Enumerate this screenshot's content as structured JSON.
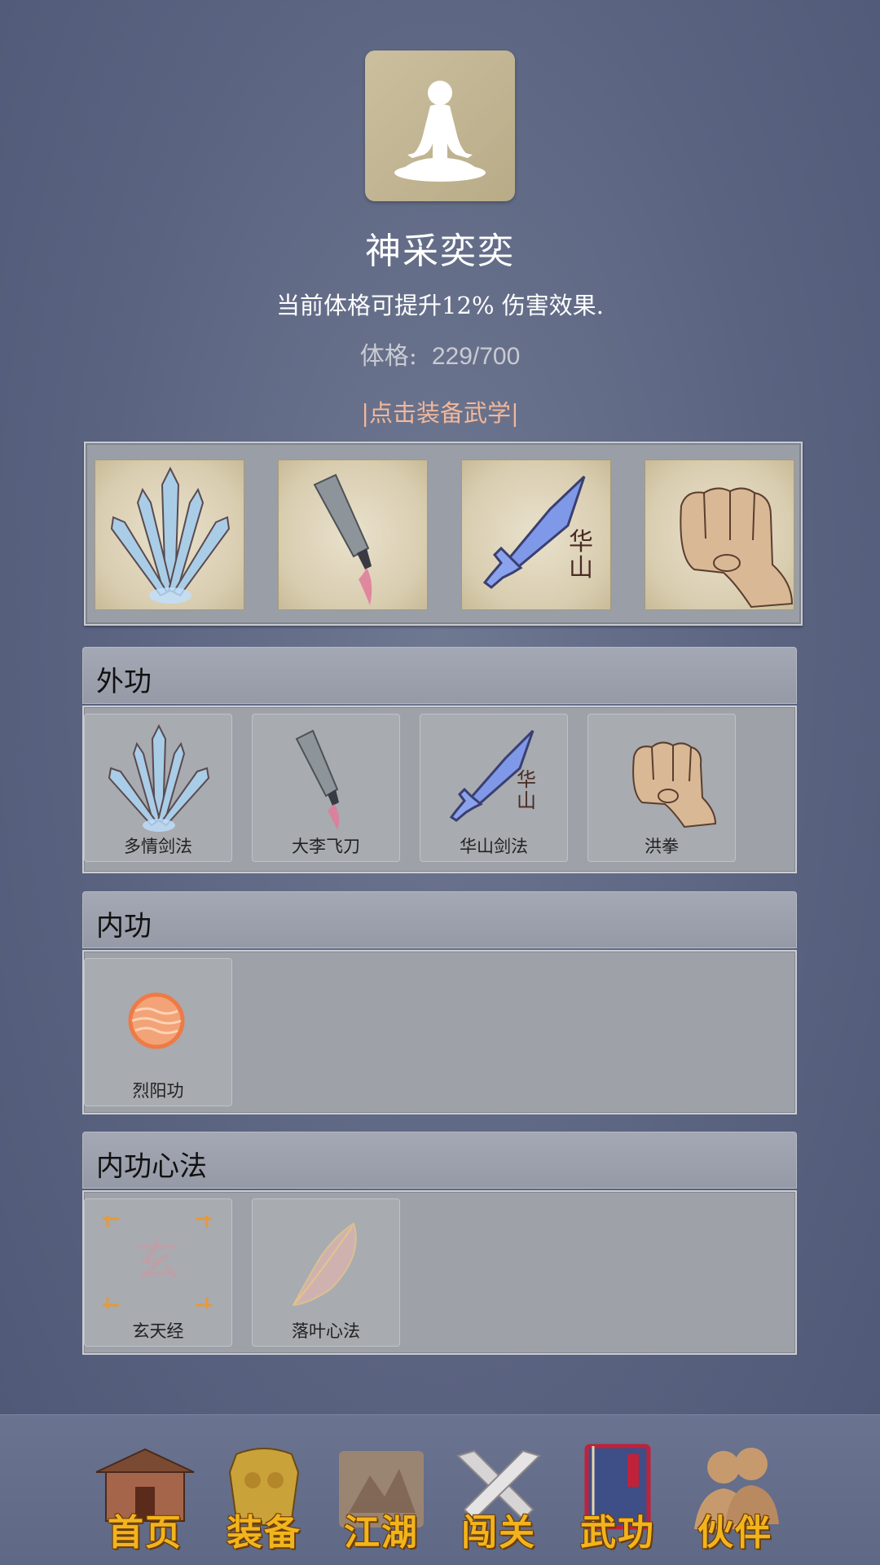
{
  "header": {
    "title": "神采奕奕",
    "description": "当前体格可提升12% 伤害效果.",
    "stat_label": "体格:",
    "stat_value": "229/700",
    "equip_hint": "|点击装备武学|"
  },
  "equipped_slots": [
    {
      "icon": "multi-sword-icon"
    },
    {
      "icon": "flying-knife-icon"
    },
    {
      "icon": "huashan-sword-icon",
      "badge": "华山"
    },
    {
      "icon": "fist-icon"
    }
  ],
  "sections": {
    "waigong": {
      "title": "外功",
      "skills": [
        {
          "name": "多情剑法",
          "icon": "multi-sword-icon"
        },
        {
          "name": "大李飞刀",
          "icon": "flying-knife-icon"
        },
        {
          "name": "华山剑法",
          "icon": "huashan-sword-icon",
          "badge": "华山"
        },
        {
          "name": "洪拳",
          "icon": "fist-icon"
        }
      ]
    },
    "neigong": {
      "title": "内功",
      "skills": [
        {
          "name": "烈阳功",
          "icon": "sun-orb-icon"
        }
      ]
    },
    "xinfa": {
      "title": "内功心法",
      "skills": [
        {
          "name": "玄天经",
          "icon": "xuan-scroll-icon",
          "glyph": "玄"
        },
        {
          "name": "落叶心法",
          "icon": "leaf-icon"
        }
      ]
    }
  },
  "nav": [
    {
      "label": "首页",
      "icon": "temple-icon"
    },
    {
      "label": "装备",
      "icon": "armor-icon"
    },
    {
      "label": "江湖",
      "icon": "mountain-scroll-icon"
    },
    {
      "label": "闯关",
      "icon": "crossed-swords-icon"
    },
    {
      "label": "武功",
      "icon": "book-icon",
      "active": true
    },
    {
      "label": "伙伴",
      "icon": "companions-icon"
    }
  ],
  "colors": {
    "background": "#5a6380",
    "hint": "#f2b79a",
    "nav_label": "#f2b41c"
  }
}
